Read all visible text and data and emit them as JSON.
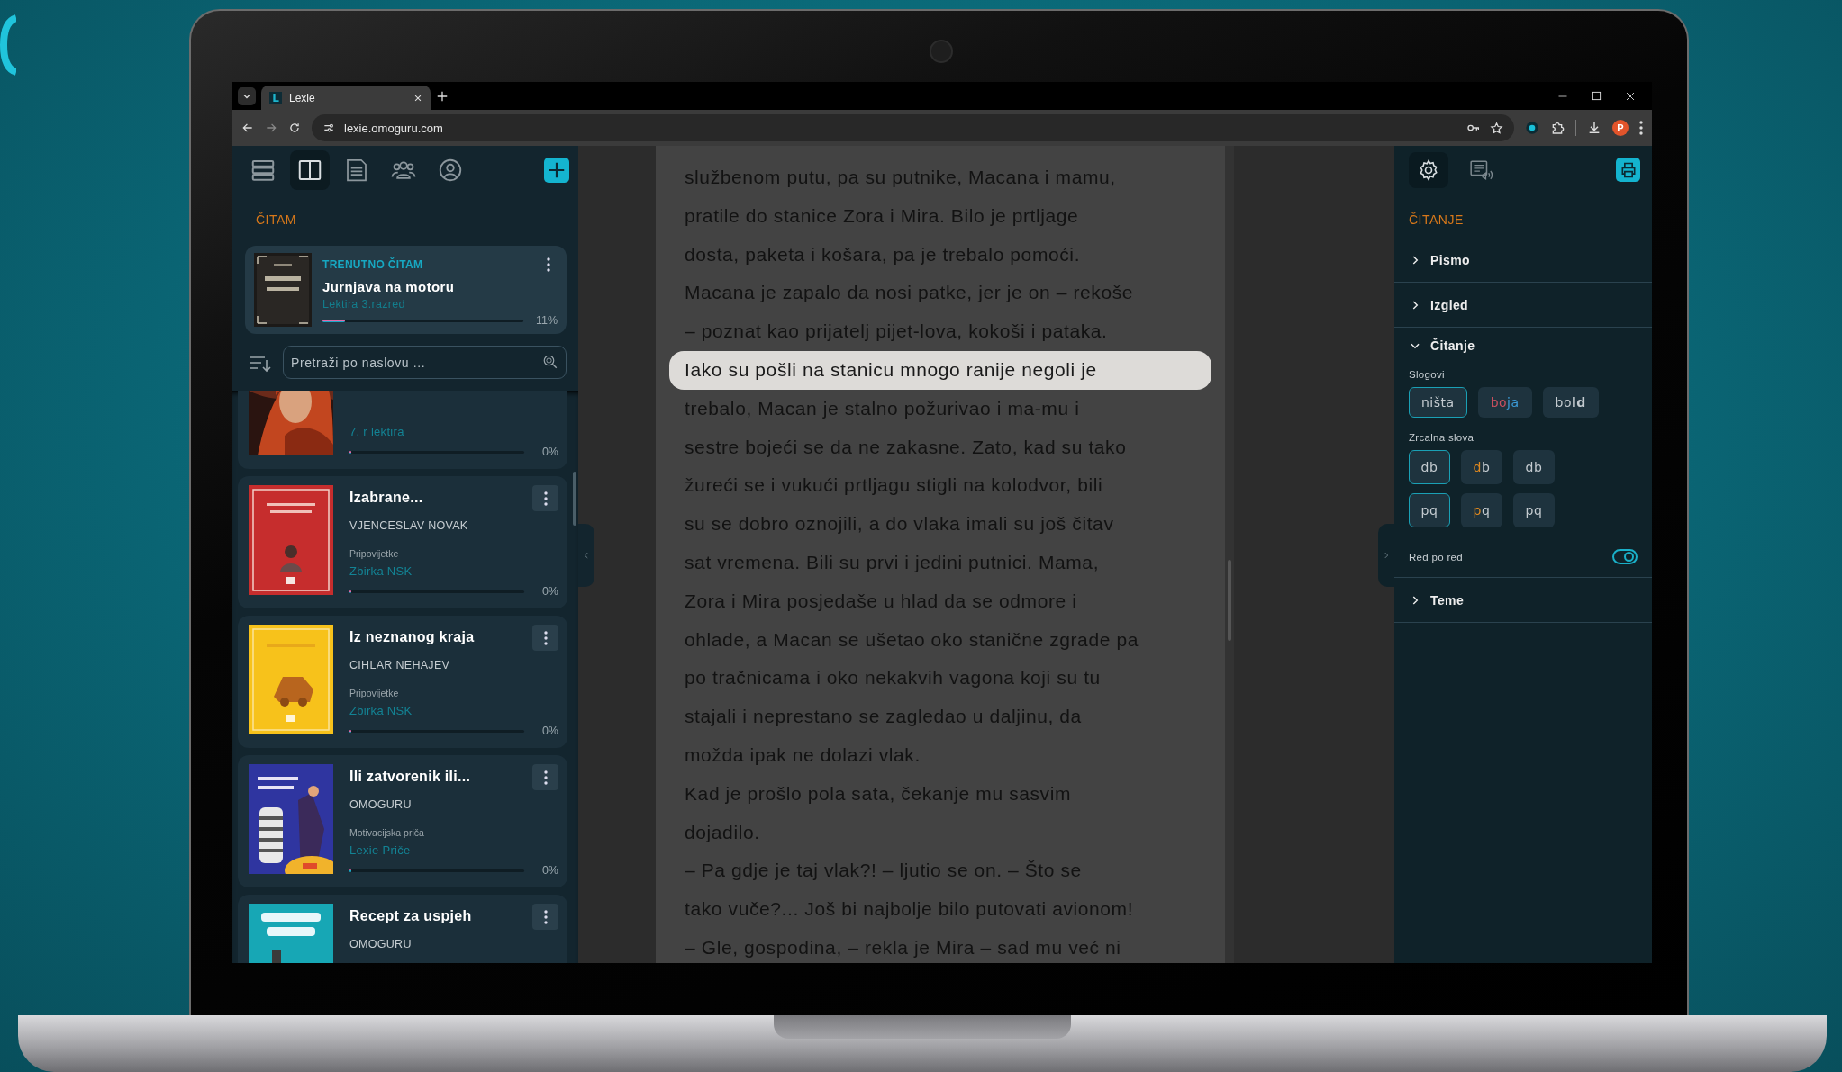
{
  "browser": {
    "tab_title": "Lexie",
    "tab_logo": "L",
    "url": "lexie.omoguru.com",
    "profile_initial": "P"
  },
  "sidebar": {
    "nav": [
      {
        "selected": false
      },
      {
        "selected": true
      },
      {
        "selected": false
      },
      {
        "selected": false
      },
      {
        "selected": false
      }
    ],
    "section_title": "ČITAM",
    "current": {
      "label": "TRENUTNO ČITAM",
      "title": "Jurnjava na motoru",
      "collection": "Lektira 3.razred",
      "level": 0.11,
      "percent": "11%"
    },
    "search": {
      "placeholder": "Pretraži po naslovu ..."
    },
    "books": [
      {
        "collection": "7. r lektira",
        "level": 0,
        "percent": "0%"
      },
      {
        "title": "Izabrane...",
        "author": "VJENCESLAV NOVAK",
        "genre": "Pripovijetke",
        "collection": "Zbirka NSK",
        "level": 0,
        "percent": "0%"
      },
      {
        "title": "Iz neznanog kraja",
        "author": "CIHLAR NEHAJEV",
        "genre": "Pripovijetke",
        "collection": "Zbirka NSK",
        "level": 0,
        "percent": "0%"
      },
      {
        "title": "Ili zatvorenik ili...",
        "author": "OMOGURU",
        "genre": "Motivacijska priča",
        "collection": "Lexie Priče",
        "level": 0,
        "percent": "0%"
      },
      {
        "title": "Recept za uspjeh",
        "author": "OMOGURU"
      }
    ]
  },
  "reader": {
    "lines": [
      {
        "text": "službenom putu, pa su putnike, Macana i mamu,",
        "highlighted": false
      },
      {
        "text": "pratile do stanice Zora i Mira. Bilo je prtljage",
        "highlighted": false
      },
      {
        "text": "dosta, paketa i košara, pa je trebalo pomoći.",
        "highlighted": false
      },
      {
        "text": "Macana je zapalo da nosi patke, jer je on – rekoše",
        "highlighted": false
      },
      {
        "text": "– poznat kao prijatelj pijet-lova, kokoši i pataka.",
        "highlighted": false
      },
      {
        "text": "Iako su pošli na stanicu mnogo ranije negoli je",
        "highlighted": true
      },
      {
        "text": "trebalo, Macan je stalno požurivao i ma-mu i",
        "highlighted": false
      },
      {
        "text": "sestre bojeći se da ne zakasne. Zato, kad su tako",
        "highlighted": false
      },
      {
        "text": "žureći se i vukući prtljagu stigli na kolodvor, bili",
        "highlighted": false
      },
      {
        "text": "su se dobro oznojili, a do vlaka imali su još čitav",
        "highlighted": false
      },
      {
        "text": "sat vremena. Bili su prvi i jedini putnici. Mama,",
        "highlighted": false
      },
      {
        "text": "Zora i Mira posjedaše u hlad da se odmore i",
        "highlighted": false
      },
      {
        "text": "ohlade, a Macan se ušetao oko stanične zgrade pa",
        "highlighted": false
      },
      {
        "text": "po tračnicama i oko nekakvih vagona koji su tu",
        "highlighted": false
      },
      {
        "text": "stajali i neprestano se zagledao u daljinu, da",
        "highlighted": false
      },
      {
        "text": "možda ipak ne dolazi vlak.",
        "highlighted": false
      },
      {
        "text": "Kad je prošlo pola sata, čekanje mu sasvim",
        "highlighted": false
      },
      {
        "text": "dojadilo.",
        "highlighted": false
      },
      {
        "text": "– Pa gdje je taj vlak?! – ljutio se on. – Što se",
        "highlighted": false
      },
      {
        "text": "tako vuče?... Još bi najbolje bilo putovati avionom!",
        "highlighted": false
      },
      {
        "text": "– Gle, gospodina, – rekla je Mira – sad mu već ni",
        "highlighted": false
      }
    ]
  },
  "settings": {
    "nav": [
      {
        "selected": true
      },
      {
        "selected": false
      }
    ],
    "title": "ČITANJE",
    "sections": [
      {
        "label": "Pismo",
        "expanded": false
      },
      {
        "label": "Izgled",
        "expanded": false
      },
      {
        "label": "Čitanje",
        "expanded": true,
        "content": {
          "syllables": {
            "label": "Slogovi",
            "options": [
              {
                "parts": [
                  {
                    "text": "ništa"
                  }
                ],
                "selected": true
              },
              {
                "parts": [
                  {
                    "text": "bo",
                    "color": "#c9505f"
                  },
                  {
                    "text": "ja",
                    "color": "#3b9bd8"
                  }
                ],
                "selected": false
              },
              {
                "parts": [
                  {
                    "text": "bo"
                  },
                  {
                    "text": "ld",
                    "bold": true
                  }
                ],
                "selected": false
              }
            ]
          },
          "mirror": {
            "label": "Zrcalna slova",
            "rows": [
              [
                {
                  "parts": [
                    {
                      "text": "db"
                    }
                  ],
                  "selected": true
                },
                {
                  "parts": [
                    {
                      "text": "d",
                      "color": "#e0891f"
                    },
                    {
                      "text": "b"
                    }
                  ],
                  "selected": false
                },
                {
                  "parts": [
                    {
                      "text": "db"
                    }
                  ],
                  "selected": false
                }
              ],
              [
                {
                  "parts": [
                    {
                      "text": "pq"
                    }
                  ],
                  "selected": true
                },
                {
                  "parts": [
                    {
                      "text": "p",
                      "color": "#e0891f"
                    },
                    {
                      "text": "q"
                    }
                  ],
                  "selected": false
                },
                {
                  "parts": [
                    {
                      "text": "pq"
                    }
                  ],
                  "selected": false
                }
              ]
            ]
          },
          "line_by_line": {
            "label": "Red po red",
            "on": true
          }
        }
      },
      {
        "label": "Teme",
        "expanded": false
      }
    ]
  }
}
